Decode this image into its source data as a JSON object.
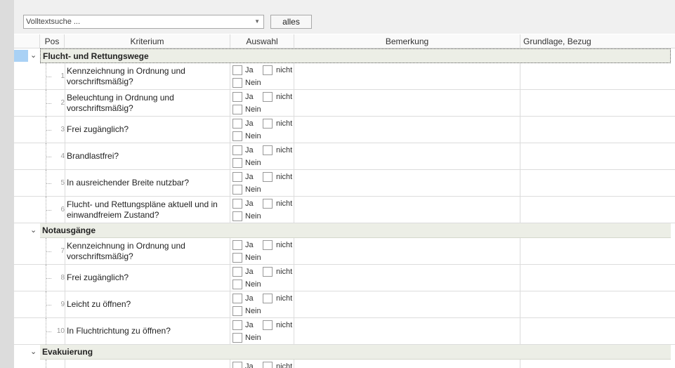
{
  "search": {
    "placeholder": "Volltextsuche ...",
    "all_label": "alles"
  },
  "columns": {
    "pos": "Pos",
    "kriterium": "Kriterium",
    "auswahl": "Auswahl",
    "bemerkung": "Bemerkung",
    "grundlage": "Grundlage, Bezug"
  },
  "options": {
    "ja": "Ja",
    "nein": "Nein",
    "nicht": "nicht"
  },
  "groups": [
    {
      "title": "Flucht- und Rettungswege",
      "items": [
        {
          "pos": "1",
          "text": "Kennzeichnung in Ordnung und vorschriftsmäßig?"
        },
        {
          "pos": "2",
          "text": "Beleuchtung in Ordnung und vorschriftsmäßig?"
        },
        {
          "pos": "3",
          "text": "Frei zugänglich?"
        },
        {
          "pos": "4",
          "text": "Brandlastfrei?"
        },
        {
          "pos": "5",
          "text": "In ausreichender Breite nutzbar?"
        },
        {
          "pos": "6",
          "text": "Flucht- und Rettungspläne aktuell und in einwandfreiem Zustand?"
        }
      ]
    },
    {
      "title": "Notausgänge",
      "items": [
        {
          "pos": "7",
          "text": "Kennzeichnung in Ordnung und vorschriftsmäßig?"
        },
        {
          "pos": "8",
          "text": "Frei zugänglich?"
        },
        {
          "pos": "9",
          "text": "Leicht zu öffnen?"
        },
        {
          "pos": "10",
          "text": "In Fluchtrichtung zu öffnen?"
        }
      ]
    },
    {
      "title": "Evakuierung",
      "items": [
        {
          "pos": "",
          "text": ""
        }
      ]
    }
  ]
}
